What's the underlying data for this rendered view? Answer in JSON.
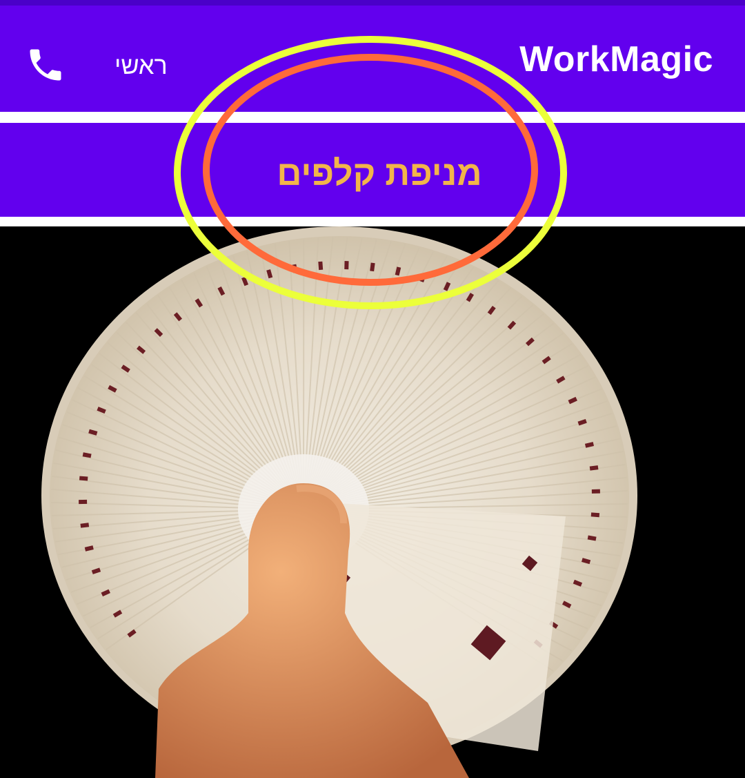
{
  "app_bar": {
    "title": "WorkMagic",
    "home_label": "ראשי",
    "phone_icon": "phone-icon",
    "background": "#6200ee"
  },
  "page": {
    "heading": "מניפת קלפים",
    "heading_color": "#f2b54a"
  },
  "image": {
    "subject": "card-fan-photo",
    "suit": "diamonds"
  },
  "annotation": {
    "outer_ellipse_color": "#ecff3a",
    "inner_ellipse_color": "#ff6a3a"
  }
}
